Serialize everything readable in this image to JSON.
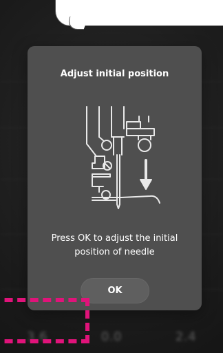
{
  "dialog": {
    "title": "Adjust initial position",
    "message": "Press OK to adjust the initial\nposition of needle",
    "ok_label": "OK"
  },
  "illustration": {
    "icon": "needle-adjust-illustration-icon",
    "arrow_direction": "down"
  },
  "background_values": {
    "value_1": "3.6",
    "value_2": "0.0",
    "value_3": "2.4"
  },
  "colors": {
    "modal_bg": "#4f4f4f",
    "button_bg": "#5f5f5f",
    "highlight": "#e0137a",
    "text": "#ffffff"
  }
}
